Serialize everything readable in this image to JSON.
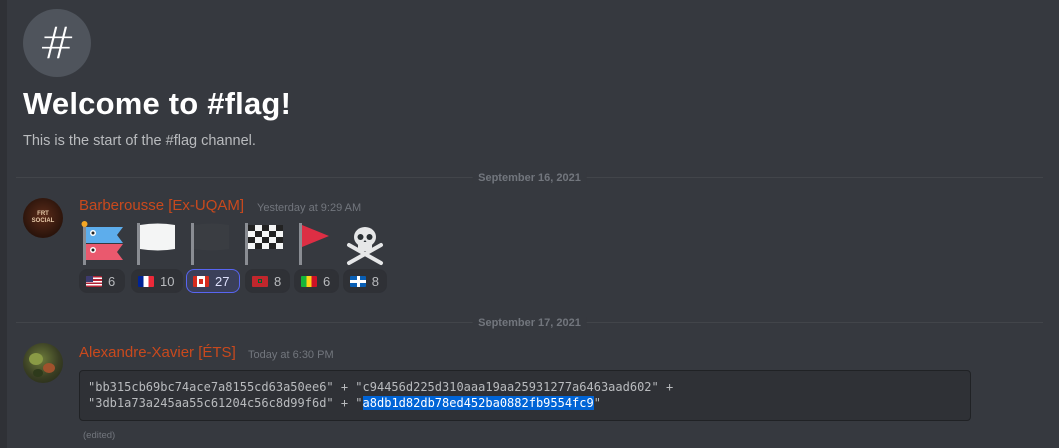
{
  "channel": {
    "icon": "hashtag-icon",
    "icon_glyph": "#",
    "welcome_title": "Welcome to #flag!",
    "welcome_subtitle": "This is the start of the #flag channel."
  },
  "dividers": [
    "September 16, 2021",
    "September 17, 2021"
  ],
  "messages": [
    {
      "author": "Barberousse [Ex-UQAM]",
      "avatar_text": "FRT SOCIAL",
      "timestamp": "Yesterday at 9:29 AM",
      "emojis": [
        "carp-streamer-flag-emoji",
        "white-flag-emoji",
        "black-flag-emoji",
        "chequered-flag-emoji",
        "triangular-red-flag-emoji",
        "skull-and-crossbones-emoji"
      ],
      "reactions": [
        {
          "flag": "us-flag-icon",
          "count": "6",
          "active": false
        },
        {
          "flag": "france-flag-icon",
          "count": "10",
          "active": false
        },
        {
          "flag": "canada-flag-icon",
          "count": "27",
          "active": true
        },
        {
          "flag": "morocco-flag-icon",
          "count": "8",
          "active": false
        },
        {
          "flag": "mali-flag-icon",
          "count": "6",
          "active": false
        },
        {
          "flag": "quebec-flag-icon",
          "count": "8",
          "active": false
        }
      ]
    },
    {
      "author": "Alexandre-Xavier [ÉTS]",
      "timestamp": "Today at 6:30 PM",
      "code_line1": "\"bb315cb69bc74ace7a8155cd63a50ee6\" + \"c94456d225d310aaa19aa25931277a6463aad602\" +",
      "code_line2_pre": "\"3db1a73a245aa55c61204c56c8d99f6d\" + \"",
      "code_line2_selected": "a8db1d82db78ed452ba0882fb9554fc9",
      "code_line2_post": "\"",
      "edited_label": "(edited)"
    }
  ],
  "colors": {
    "background": "#36393f",
    "author": "#c9491d",
    "selection": "#0064d6",
    "reaction_active_border": "#5865f2"
  }
}
